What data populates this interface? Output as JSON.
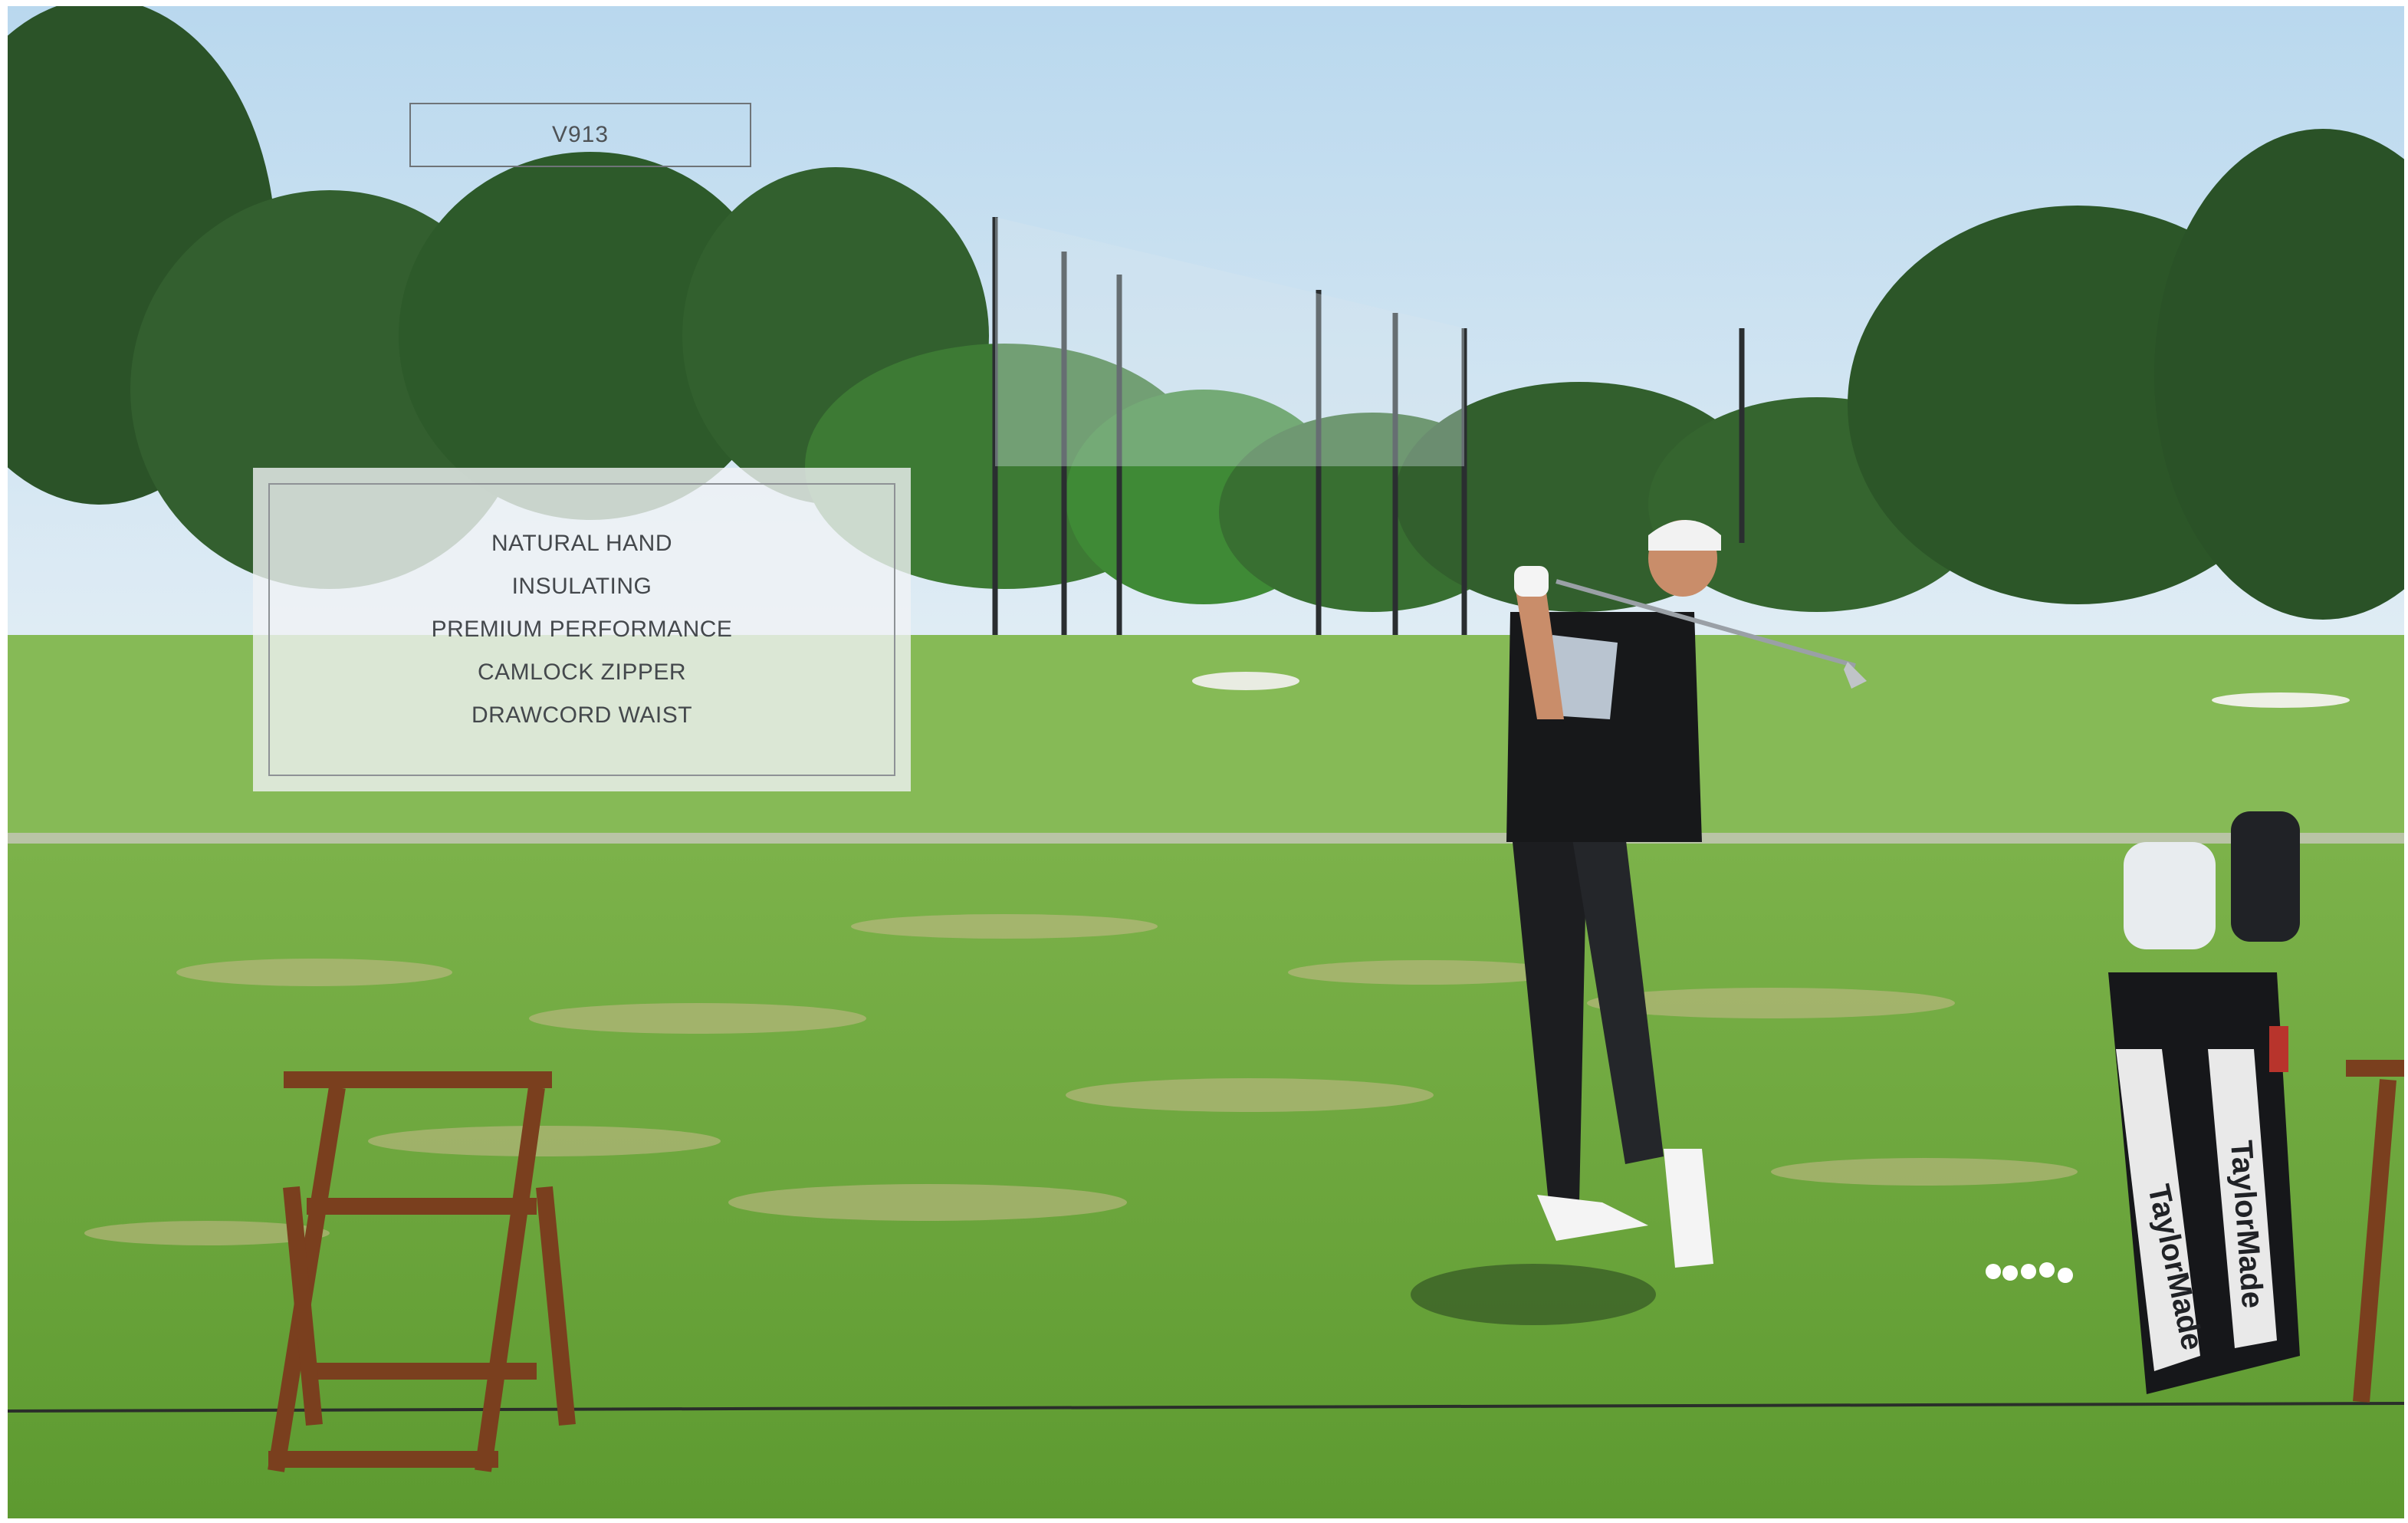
{
  "product": {
    "code": "V913"
  },
  "features": [
    "NATURAL HAND",
    "INSULATING",
    "PREMIUM PERFORMANCE",
    "CAMLOCK ZIPPER",
    "DRAWCORD WAIST"
  ],
  "bag": {
    "brand_text": "TaylorMade"
  },
  "colors": {
    "sky": "#c9e2f3",
    "fairway": "#7fb24e",
    "range_grass": "#6fa43a",
    "text": "#4e5256"
  }
}
